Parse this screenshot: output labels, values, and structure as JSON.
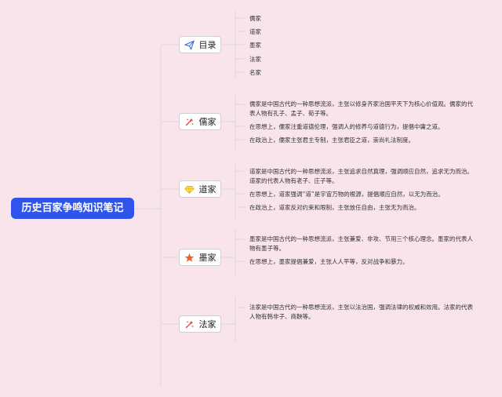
{
  "root": {
    "title": "历史百家争鸣知识笔记"
  },
  "branches": [
    {
      "label": "目录",
      "icon": "paper-plane-icon",
      "color": "#3b6fd8"
    },
    {
      "label": "儒家",
      "icon": "sparkle-icon",
      "color": "#e53935"
    },
    {
      "label": "道家",
      "icon": "gem-icon",
      "color": "#f5c518"
    },
    {
      "label": "墨家",
      "icon": "star-icon",
      "color": "#e8632b"
    },
    {
      "label": "法家",
      "icon": "sparkle-icon",
      "color": "#e53935"
    }
  ],
  "toc_items": [
    "儒家",
    "道家",
    "墨家",
    "法家",
    "名家"
  ],
  "notes": {
    "rujia": [
      "儒家是中国古代的一种思想流派，主张以修身齐家治国平天下为核心价值观。儒家的代表人物有孔子、孟子、荀子等。",
      "在思想上，儒家注重道德伦理，强调人的修养与道德行为，提倡中庸之道。",
      "在政治上，儒家主张君主专制，主张君臣之道，崇尚礼法制度。"
    ],
    "daojia": [
      "道家是中国古代的一种思想流派，主张追求自然真理，强调顺应自然，追求无为而治。道家的代表人物有老子、庄子等。",
      "在思想上，道家强调“道”是宇宙万物的根源，提倡顺应自然，以无为而治。",
      "在政治上，道家反对约束和限制，主张放任自由，主张无为而治。"
    ],
    "mojia": [
      "墨家是中国古代的一种思想流派，主张兼爱、非攻、节用三个核心理念。墨家的代表人物有墨子等。",
      "在思想上，墨家提倡兼爱，主张人人平等，反对战争和暴力。"
    ],
    "fajia": [
      "法家是中国古代的一种思想流派，主张以法治国，强调法律的权威和效用。法家的代表人物有韩非子、商鞅等。"
    ]
  },
  "colors": {
    "background": "#f9e4ec",
    "root": "#2f54eb",
    "line": "#d9d9d9"
  }
}
